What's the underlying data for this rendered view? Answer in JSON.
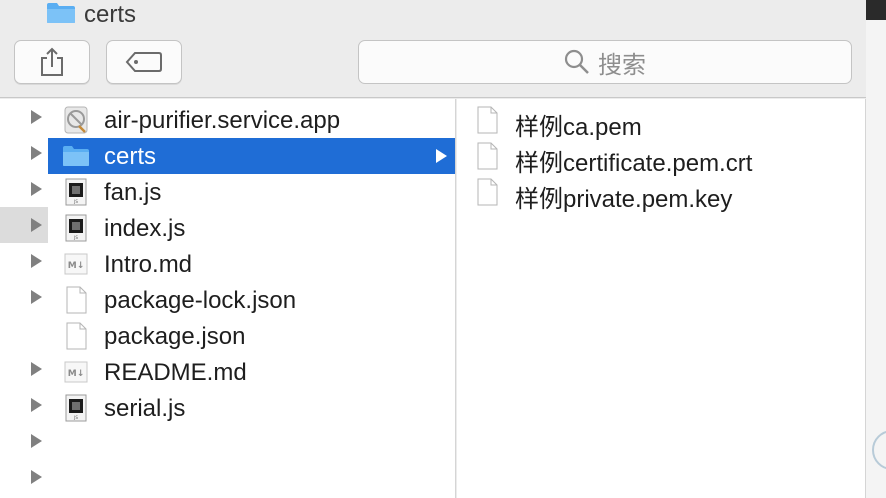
{
  "window": {
    "title": "certs"
  },
  "toolbar": {
    "share_icon": "share-icon",
    "tag_icon": "tag-icon",
    "search": {
      "placeholder": "搜索",
      "icon": "search-icon"
    }
  },
  "column1": {
    "items": [
      {
        "label": "air-purifier.service.app",
        "icon": "app-icon"
      },
      {
        "label": "certs",
        "icon": "folder-icon",
        "selected": true
      },
      {
        "label": "fan.js",
        "icon": "js-file-icon"
      },
      {
        "label": "index.js",
        "icon": "js-file-icon"
      },
      {
        "label": "Intro.md",
        "icon": "markdown-file-icon"
      },
      {
        "label": "package-lock.json",
        "icon": "document-icon"
      },
      {
        "label": "package.json",
        "icon": "document-icon"
      },
      {
        "label": "README.md",
        "icon": "markdown-file-icon"
      },
      {
        "label": "serial.js",
        "icon": "js-file-icon"
      }
    ]
  },
  "column2": {
    "items": [
      {
        "label": "样例ca.pem",
        "icon": "document-icon"
      },
      {
        "label": "样例certificate.pem.crt",
        "icon": "document-icon"
      },
      {
        "label": "样例private.pem.key",
        "icon": "document-icon"
      }
    ]
  },
  "colors": {
    "selection": "#1f6dd6",
    "folder": "#5aaef2",
    "background": "#ececec"
  }
}
